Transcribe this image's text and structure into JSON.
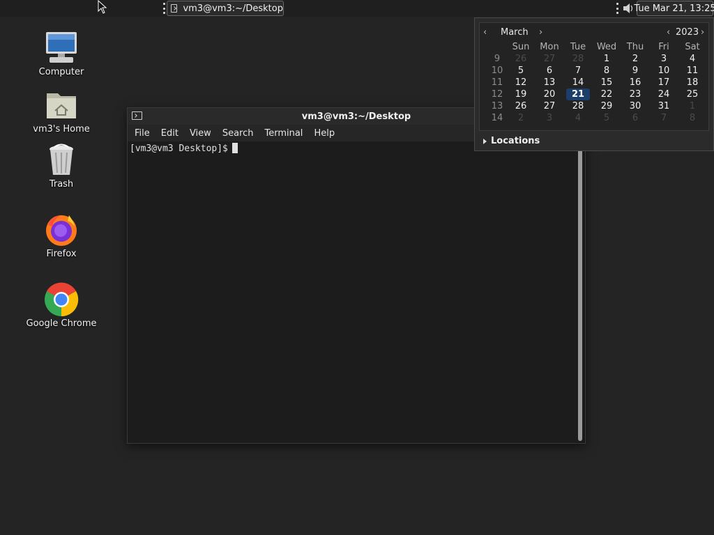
{
  "top_panel": {
    "task_button": {
      "label": "vm3@vm3:~/Desktop",
      "icon": "terminal-icon"
    },
    "volume_icon": "speaker-icon",
    "clock": "Tue Mar 21, 13:25"
  },
  "desktop": {
    "icons": [
      {
        "label": "Computer",
        "icon": "computer-icon"
      },
      {
        "label": "vm3's Home",
        "icon": "home-folder-icon"
      },
      {
        "label": "Trash",
        "icon": "trash-icon"
      },
      {
        "label": "Firefox",
        "icon": "firefox-icon"
      },
      {
        "label": "Google Chrome",
        "icon": "chrome-icon"
      }
    ]
  },
  "terminal": {
    "title": "vm3@vm3:~/Desktop",
    "menu": [
      "File",
      "Edit",
      "View",
      "Search",
      "Terminal",
      "Help"
    ],
    "prompt": "[vm3@vm3 Desktop]$"
  },
  "calendar": {
    "month": "March",
    "year": "2023",
    "weekdays": [
      "Sun",
      "Mon",
      "Tue",
      "Wed",
      "Thu",
      "Fri",
      "Sat"
    ],
    "weeks": [
      {
        "num": "9",
        "days": [
          [
            "26",
            "dim"
          ],
          [
            "27",
            "dim"
          ],
          [
            "28",
            "dim"
          ],
          [
            "1",
            ""
          ],
          [
            "2",
            ""
          ],
          [
            "3",
            ""
          ],
          [
            "4",
            ""
          ]
        ]
      },
      {
        "num": "10",
        "days": [
          [
            "5",
            ""
          ],
          [
            "6",
            ""
          ],
          [
            "7",
            ""
          ],
          [
            "8",
            ""
          ],
          [
            "9",
            ""
          ],
          [
            "10",
            ""
          ],
          [
            "11",
            ""
          ]
        ]
      },
      {
        "num": "11",
        "days": [
          [
            "12",
            ""
          ],
          [
            "13",
            ""
          ],
          [
            "14",
            ""
          ],
          [
            "15",
            ""
          ],
          [
            "16",
            ""
          ],
          [
            "17",
            ""
          ],
          [
            "18",
            ""
          ]
        ]
      },
      {
        "num": "12",
        "days": [
          [
            "19",
            ""
          ],
          [
            "20",
            ""
          ],
          [
            "21",
            "today"
          ],
          [
            "22",
            ""
          ],
          [
            "23",
            ""
          ],
          [
            "24",
            ""
          ],
          [
            "25",
            ""
          ]
        ]
      },
      {
        "num": "13",
        "days": [
          [
            "26",
            ""
          ],
          [
            "27",
            ""
          ],
          [
            "28",
            ""
          ],
          [
            "29",
            ""
          ],
          [
            "30",
            ""
          ],
          [
            "31",
            ""
          ],
          [
            "1",
            "dim"
          ]
        ]
      },
      {
        "num": "14",
        "days": [
          [
            "2",
            "dim"
          ],
          [
            "3",
            "dim"
          ],
          [
            "4",
            "dim"
          ],
          [
            "5",
            "dim"
          ],
          [
            "6",
            "dim"
          ],
          [
            "7",
            "dim"
          ],
          [
            "8",
            "dim"
          ]
        ]
      }
    ],
    "locations_label": "Locations",
    "colors": {
      "today_bg": "#1c3e6a",
      "panel_bg": "#1f1f1f",
      "desktop_bg": "#242424"
    }
  }
}
